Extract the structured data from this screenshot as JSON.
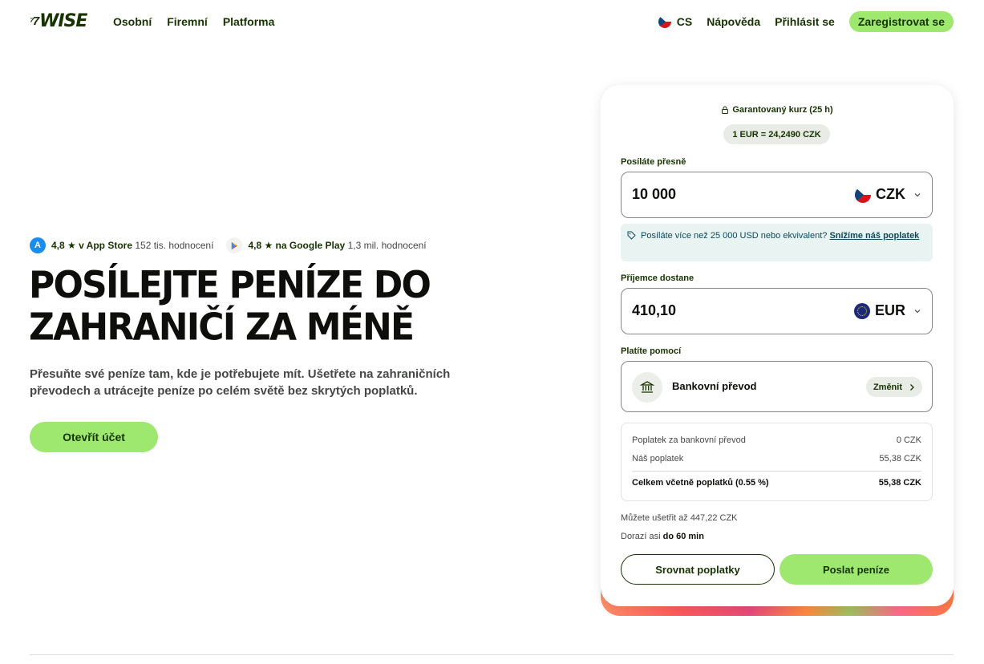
{
  "header": {
    "logo_mark": "⁷7",
    "logo_text": "WISE",
    "nav": [
      "Osobní",
      "Firemní",
      "Platforma"
    ],
    "lang": "CS",
    "help": "Nápověda",
    "login": "Přihlásit se",
    "register": "Zaregistrovat se"
  },
  "hero": {
    "appstore": {
      "rating": "4,8 ★ v App Store",
      "count": "152 tis. hodnocení"
    },
    "googleplay": {
      "rating": "4,8 ★ na Google Play",
      "count": "1,3 mil. hodnocení"
    },
    "title": "POSÍLEJTE PENÍZE DO ZAHRANIČÍ ZA MÉNĚ",
    "subtitle": "Přesuňte své peníze tam, kde je potřebujete mít. Ušetřete na zahraničních převodech a utrácejte peníze po celém světě bez skrytých poplatků.",
    "cta": "Otevřít účet"
  },
  "calculator": {
    "rate_label": "Garantovaný kurz (25 h)",
    "rate_value": "1 EUR = 24,2490 CZK",
    "send_label": "Posíláte přesně",
    "send_amount": "10 000",
    "send_currency": "CZK",
    "notice_text": "Posíláte více než 25 000 USD nebo ekvivalent?",
    "notice_link": "Snížíme náš poplatek",
    "receive_label": "Příjemce dostane",
    "receive_amount": "410,10",
    "receive_currency": "EUR",
    "pay_label": "Platíte pomocí",
    "pay_method": "Bankovní převod",
    "change_button": "Změnit",
    "fees": [
      {
        "label": "Poplatek za bankovní převod",
        "value": "0 CZK"
      },
      {
        "label": "Náš poplatek",
        "value": "55,38 CZK"
      }
    ],
    "total_label": "Celkem včetně poplatků (0.55 %)",
    "total_value": "55,38 CZK",
    "savings": "Můžete ušetřit až 447,22 CZK",
    "eta_prefix": "Dorazí asi",
    "eta_value": "do 60 min",
    "compare_button": "Srovnat poplatky",
    "send_button": "Poslat peníze"
  },
  "colors": {
    "brand_green": "#9fe870",
    "forest": "#163300"
  }
}
